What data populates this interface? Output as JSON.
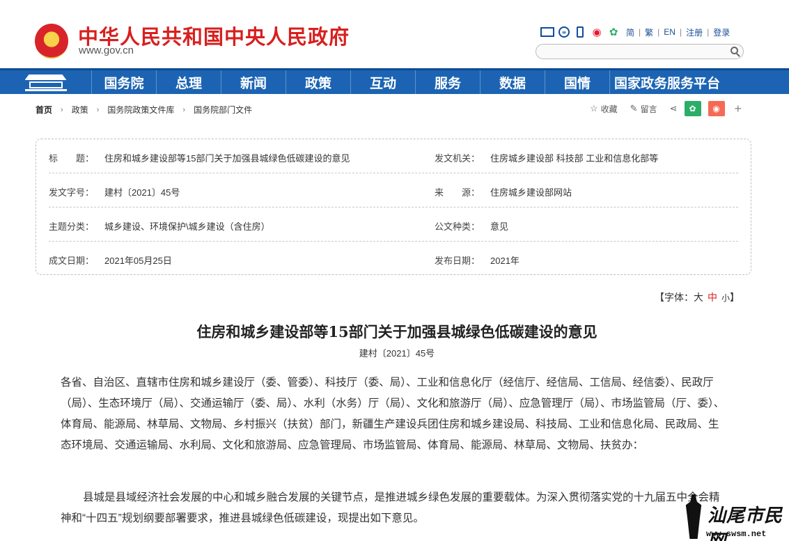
{
  "header": {
    "site_title": "中华人民共和国中央人民政府",
    "site_url": "www.gov.cn",
    "lang_links": [
      "简",
      "繁",
      "EN",
      "注册",
      "登录"
    ],
    "search_placeholder": ""
  },
  "nav": {
    "items": [
      "国务院",
      "总理",
      "新闻",
      "政策",
      "互动",
      "服务",
      "数据",
      "国情",
      "国家政务服务平台"
    ]
  },
  "breadcrumb": {
    "home": "首页",
    "items": [
      "政策",
      "国务院政策文件库",
      "国务院部门文件"
    ]
  },
  "share": {
    "favorite": "收藏",
    "comment": "留言",
    "plus": "+"
  },
  "info": {
    "title_label": "标　　题：",
    "title_value": "住房和城乡建设部等15部门关于加强县城绿色低碳建设的意见",
    "issuer_label": "发文机关：",
    "issuer_value": "住房城乡建设部 科技部 工业和信息化部等",
    "docno_label": "发文字号：",
    "docno_value": "建村〔2021〕45号",
    "source_label": "来　　源：",
    "source_value": "住房城乡建设部网站",
    "topic_label": "主题分类：",
    "topic_value": "城乡建设、环境保护\\城乡建设（含住房）",
    "type_label": "公文种类：",
    "type_value": "意见",
    "written_label": "成文日期：",
    "written_value": "2021年05月25日",
    "published_label": "发布日期：",
    "published_value": "2021年"
  },
  "font_ctl": {
    "prefix": "【字体：",
    "large": "大",
    "medium": "中",
    "small": "小",
    "suffix": "】"
  },
  "document": {
    "title": "住房和城乡建设部等15部门关于加强县城绿色低碳建设的意见",
    "number": "建村〔2021〕45号",
    "para1": "各省、自治区、直辖市住房和城乡建设厅（委、管委）、科技厅（委、局）、工业和信息化厅（经信厅、经信局、工信局、经信委）、民政厅（局）、生态环境厅（局）、交通运输厅（委、局）、水利（水务）厅（局）、文化和旅游厅（局）、应急管理厅（局）、市场监管局（厅、委）、体育局、能源局、林草局、文物局、乡村振兴（扶贫）部门，新疆生产建设兵团住房和城乡建设局、科技局、工业和信息化局、民政局、生态环境局、交通运输局、水利局、文化和旅游局、应急管理局、市场监管局、体育局、能源局、林草局、文物局、扶贫办：",
    "para2": "县城是县域经济社会发展的中心和城乡融合发展的关键节点，是推进城乡绿色发展的重要载体。为深入贯彻落实党的十九届五中全会精神和“十四五”规划纲要部署要求，推进县城绿色低碳建设，现提出如下意见。"
  },
  "watermark": {
    "text": "汕尾市民网",
    "url": "www.swsm.net"
  },
  "colors": {
    "brand_red": "#d7201e",
    "nav_blue": "#1c64b3",
    "link_blue": "#1a4f95"
  }
}
